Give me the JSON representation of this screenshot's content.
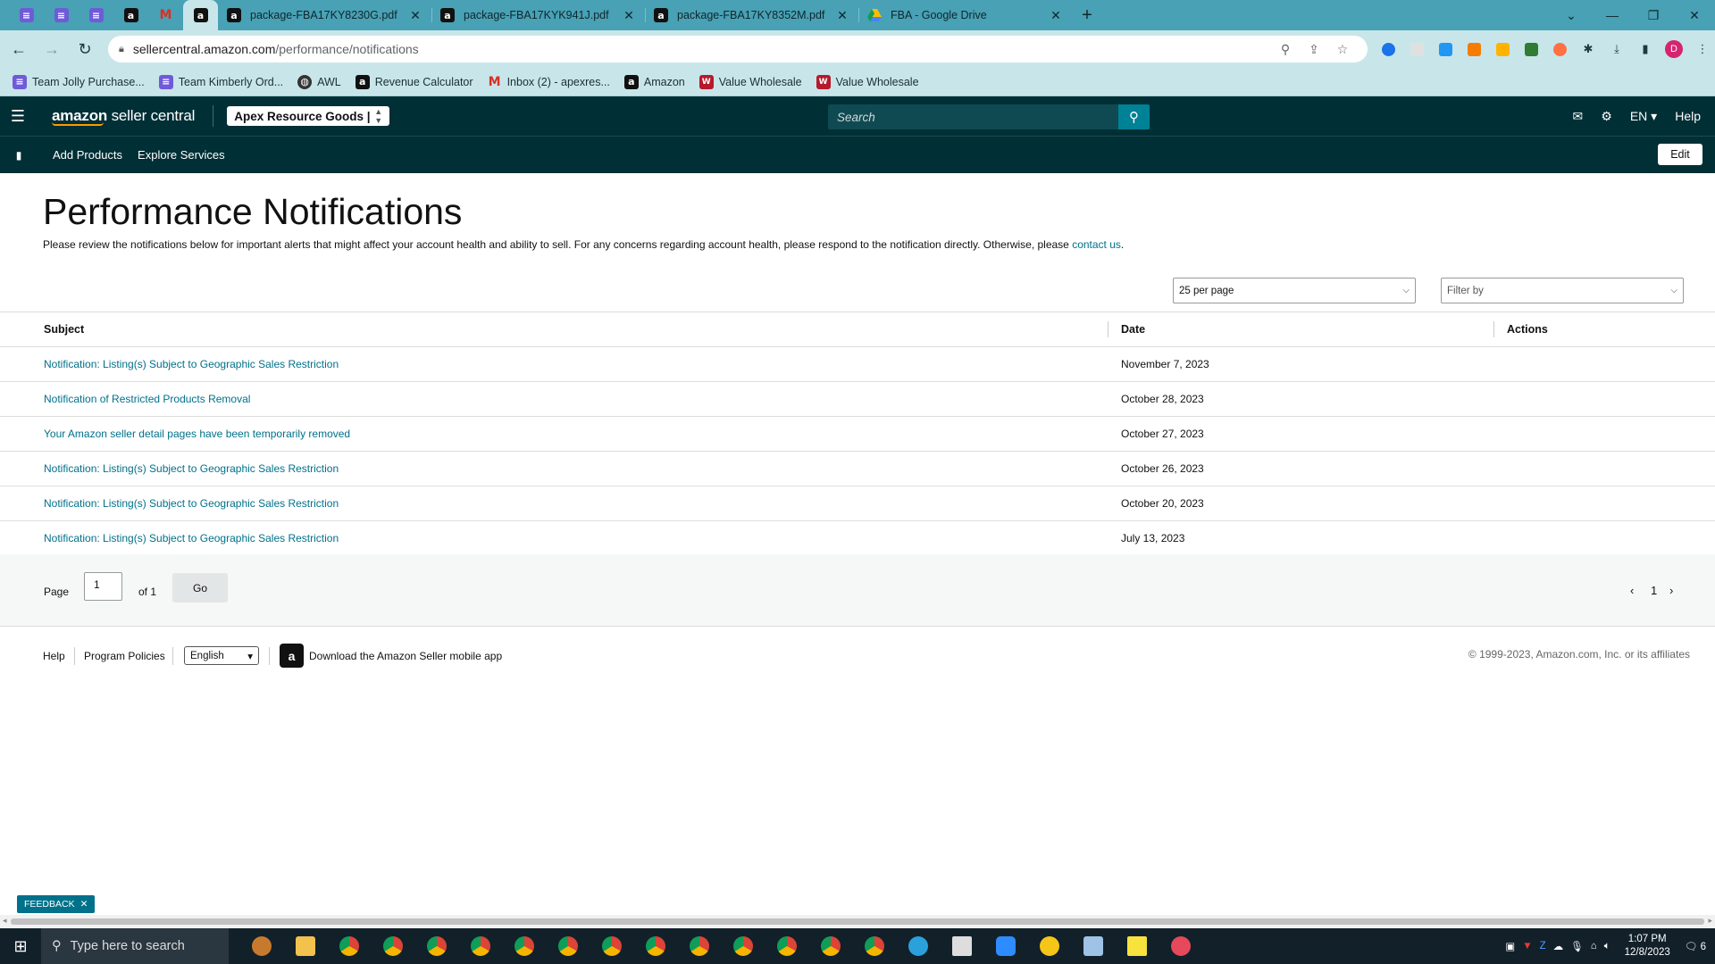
{
  "browser": {
    "tabs": [
      {
        "title": "package-FBA17KY8230G.pdf",
        "icon": "amazon-a-icon"
      },
      {
        "title": "package-FBA17KYK941J.pdf",
        "icon": "amazon-a-icon"
      },
      {
        "title": "package-FBA17KY8352M.pdf",
        "icon": "amazon-a-icon"
      },
      {
        "title": "FBA - Google Drive",
        "icon": "google-drive-icon"
      }
    ],
    "url_host": "sellercentral.amazon.com",
    "url_path": "/performance/notifications",
    "profile_initial": "D",
    "bookmarks": [
      {
        "label": "Team Jolly Purchase...",
        "icon": "sheets-icon"
      },
      {
        "label": "Team Kimberly Ord...",
        "icon": "sheets-icon"
      },
      {
        "label": "AWL",
        "icon": "globe-icon"
      },
      {
        "label": "Revenue Calculator",
        "icon": "amazon-a-icon"
      },
      {
        "label": "Inbox (2) - apexres...",
        "icon": "gmail-icon"
      },
      {
        "label": "Amazon",
        "icon": "amazon-a-icon"
      },
      {
        "label": "Value Wholesale",
        "icon": "vw-icon"
      },
      {
        "label": "Value Wholesale",
        "icon": "vw-icon"
      }
    ]
  },
  "header": {
    "logo_brand": "amazon",
    "logo_product": "seller central",
    "account_selector": "Apex Resource Goods | Unite...",
    "search_placeholder": "Search",
    "language": "EN",
    "help": "Help",
    "subnav": [
      "Add Products",
      "Explore Services"
    ],
    "edit": "Edit"
  },
  "page": {
    "title": "Performance Notifications",
    "description": "Please review the notifications below for important alerts that might affect your account health and ability to sell. For any concerns regarding account health, please respond to the notification directly. Otherwise, please ",
    "contact_link": "contact us",
    "description_end": ".",
    "per_page": "25 per page",
    "filter_placeholder": "Filter by"
  },
  "table": {
    "columns": [
      "Subject",
      "Date",
      "Actions"
    ],
    "rows": [
      {
        "subject": "Notification: Listing(s) Subject to Geographic Sales Restriction",
        "date": "November 7, 2023"
      },
      {
        "subject": "Notification of Restricted Products Removal",
        "date": "October 28, 2023"
      },
      {
        "subject": "Your Amazon seller detail pages have been temporarily removed",
        "date": "October 27, 2023"
      },
      {
        "subject": "Notification: Listing(s) Subject to Geographic Sales Restriction",
        "date": "October 26, 2023"
      },
      {
        "subject": "Notification: Listing(s) Subject to Geographic Sales Restriction",
        "date": "October 20, 2023"
      },
      {
        "subject": "Notification: Listing(s) Subject to Geographic Sales Restriction",
        "date": "July 13, 2023"
      }
    ]
  },
  "pagination": {
    "page_label": "Page",
    "page_value": "1",
    "of_label": "of 1",
    "go": "Go",
    "current_page": "1"
  },
  "footer": {
    "help": "Help",
    "program_policies": "Program Policies",
    "language": "English",
    "app_download": "Download the Amazon Seller mobile app",
    "copyright": "© 1999-2023, Amazon.com, Inc. or its affiliates"
  },
  "feedback": "FEEDBACK",
  "taskbar": {
    "search_placeholder": "Type here to search",
    "time": "1:07 PM",
    "date": "12/8/2023",
    "notification_count": "6"
  },
  "colors": {
    "tab_strip": "#48a1b5",
    "toolbar": "#c8e6ea",
    "seller_header": "#002f36",
    "link": "#00718a",
    "search_button": "#008296"
  }
}
